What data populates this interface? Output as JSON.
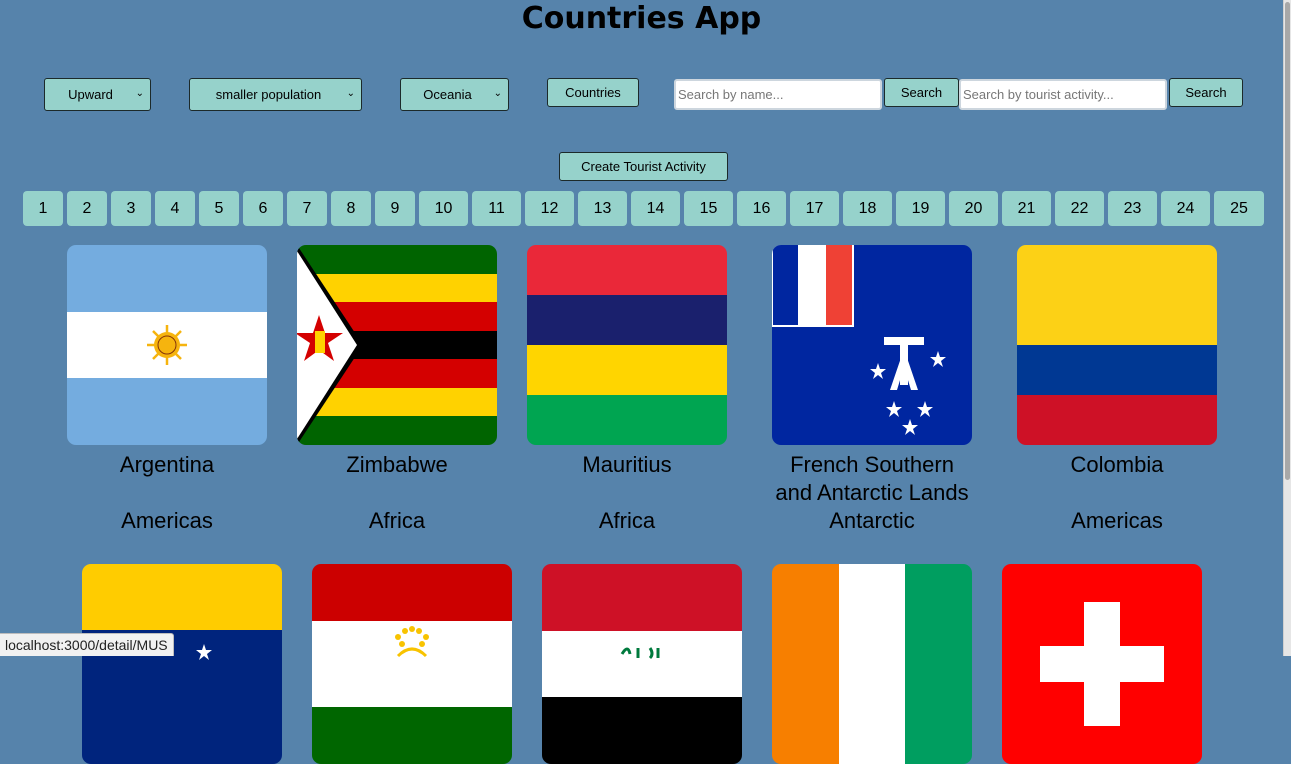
{
  "app": {
    "title": "Countries App"
  },
  "controls": {
    "order_select": "Upward",
    "sort_select": "smaller population",
    "continent_select": "Oceania",
    "countries_button": "Countries",
    "name_search": {
      "placeholder": "Search by name...",
      "button": "Search"
    },
    "activity_search": {
      "placeholder": "Search by tourist activity...",
      "button": "Search"
    },
    "create_activity_button": "Create Tourist Activity"
  },
  "pagination": [
    "1",
    "2",
    "3",
    "4",
    "5",
    "6",
    "7",
    "8",
    "9",
    "10",
    "11",
    "12",
    "13",
    "14",
    "15",
    "16",
    "17",
    "18",
    "19",
    "20",
    "21",
    "22",
    "23",
    "24",
    "25"
  ],
  "cards": [
    {
      "name": "Argentina",
      "continent": "Americas"
    },
    {
      "name": "Zimbabwe",
      "continent": "Africa"
    },
    {
      "name": "Mauritius",
      "continent": "Africa"
    },
    {
      "name": "French Southern and Antarctic Lands",
      "continent": "Antarctic"
    },
    {
      "name": "Colombia",
      "continent": "Americas"
    }
  ],
  "status_bar": {
    "url": "localhost:3000/detail/MUS"
  },
  "icons": {
    "select_caret": "chevron-down-icon"
  }
}
